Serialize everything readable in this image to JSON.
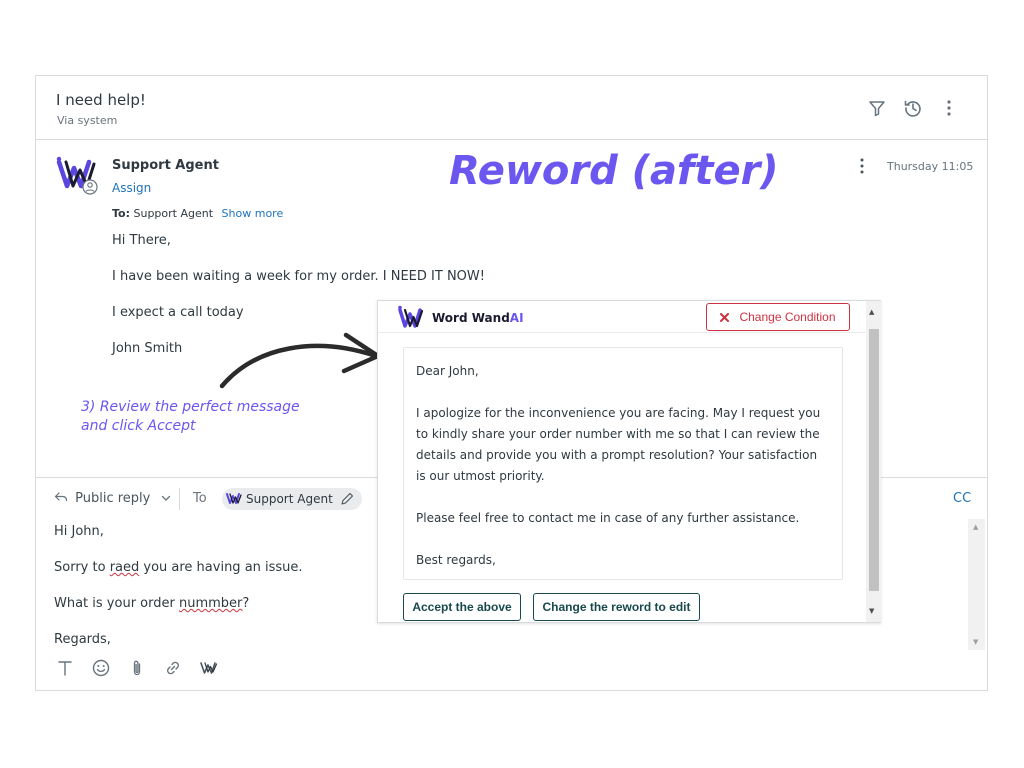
{
  "colors": {
    "accent": "#6b56f0",
    "link": "#1f73b7",
    "danger": "#cc3340",
    "button_border": "#17494d"
  },
  "ticket": {
    "subject": "I need help!",
    "via": "Via system",
    "icons": [
      "filter-icon",
      "history-icon",
      "more-vertical-icon"
    ]
  },
  "message": {
    "author": "Support Agent",
    "assign_label": "Assign",
    "timestamp": "Thursday 11:05",
    "to_label": "To:",
    "to_value": "Support Agent",
    "show_more": "Show more",
    "lines": [
      "Hi There,",
      "I have been waiting a week for my order. I NEED IT NOW!",
      "I expect a call today",
      "John Smith"
    ]
  },
  "annotation": {
    "title": "Reword (after)",
    "instruction_line1": "3) Review the perfect message",
    "instruction_line2": "and click Accept"
  },
  "reply": {
    "mode": "Public reply",
    "to_label": "To",
    "recipient": "Support Agent",
    "cc_label": "CC",
    "line1": "Hi John,",
    "line2_pre": "Sorry to ",
    "line2_misspelled": "raed",
    "line2_post": " you are having an issue.",
    "line3_pre": "What is your order ",
    "line3_misspelled": "nummber",
    "line3_post": "?",
    "line4": "Regards,",
    "toolbar_icons": [
      "text-format-icon",
      "emoji-icon",
      "attachment-icon",
      "link-icon",
      "word-wand-icon"
    ]
  },
  "popup": {
    "brand": "Word Wand",
    "brand_suffix": "AI",
    "change_condition_label": "Change Condition",
    "reword_paragraphs": [
      "Dear John,",
      "I apologize for the inconvenience you are facing. May I request you to kindly share your order number with me so that I can review the details and provide you with a prompt resolution? Your satisfaction is our utmost priority.",
      "Please feel free to contact me in case of any further assistance.",
      "Best regards,"
    ],
    "accept_label": "Accept the above",
    "edit_label": "Change the reword to edit"
  }
}
